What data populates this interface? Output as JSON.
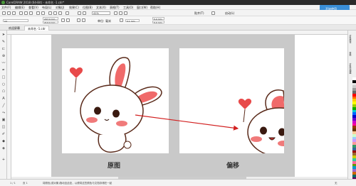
{
  "window": {
    "title": "CorelDRAW 2018 (64-Bit) - 未命名 -1.cdr*"
  },
  "menubar": {
    "items": [
      "文件(F)",
      "编辑(E)",
      "查看(V)",
      "布局(L)",
      "对象(J)",
      "效果(C)",
      "位图(B)",
      "文本(X)",
      "表格(T)",
      "工具(O)",
      "窗口(W)",
      "帮助(H)"
    ]
  },
  "promo": {
    "label": "开始使用"
  },
  "toolbar": {
    "zoom_value": "41%",
    "snap_label": "贴齐(T)",
    "launch_label": "启动(L)"
  },
  "propbar": {
    "preset": "A4",
    "width": "297.0 mm",
    "height": "210.0 mm",
    "units_label": "单位:",
    "units_value": "毫米",
    "nudge": "0.1 mm",
    "dup_x": "5.0 mm",
    "dup_y": "5.0 mm"
  },
  "doctabs": {
    "welcome": "欢迎屏幕",
    "doc": "未命名 -1.cdr"
  },
  "canvas": {
    "caption_left": "原图",
    "caption_right": "偏移"
  },
  "docker": {
    "tabs": [
      "对象属性",
      "变换",
      "对象管理器"
    ]
  },
  "palette": {
    "colors": [
      "#ffffff",
      "#000000",
      "#e6e6e6",
      "#cccccc",
      "#999999",
      "#666666",
      "#ff0000",
      "#ff6600",
      "#ffcc00",
      "#ffff00",
      "#99cc00",
      "#00aa00",
      "#00cccc",
      "#0066ff",
      "#0000cc",
      "#6600cc",
      "#cc00cc",
      "#ff0099",
      "#993300",
      "#663300",
      "#ffcc99",
      "#ccffcc",
      "#99ccff",
      "#cc99ff",
      "#ff9999",
      "#339966",
      "#336699",
      "#990000",
      "#996633",
      "#cccc00",
      "#33cc99",
      "#ff6699",
      "#669900",
      "#0099cc",
      "#9966cc",
      "#cc6600",
      "#006666",
      "#660066",
      "#ff3300",
      "#99ffff"
    ]
  },
  "status": {
    "page_nav": "1 / 1",
    "page_label": "页 1",
    "hint": "将颜色(或对象)拖动至此处，以便将这些颜色与文档存储在一起",
    "fill_label": "无"
  },
  "colors": {
    "arrow": "#d22020",
    "heart": "#e84a4a",
    "ear": "#f06a6a",
    "outline": "#5a2a1a"
  }
}
